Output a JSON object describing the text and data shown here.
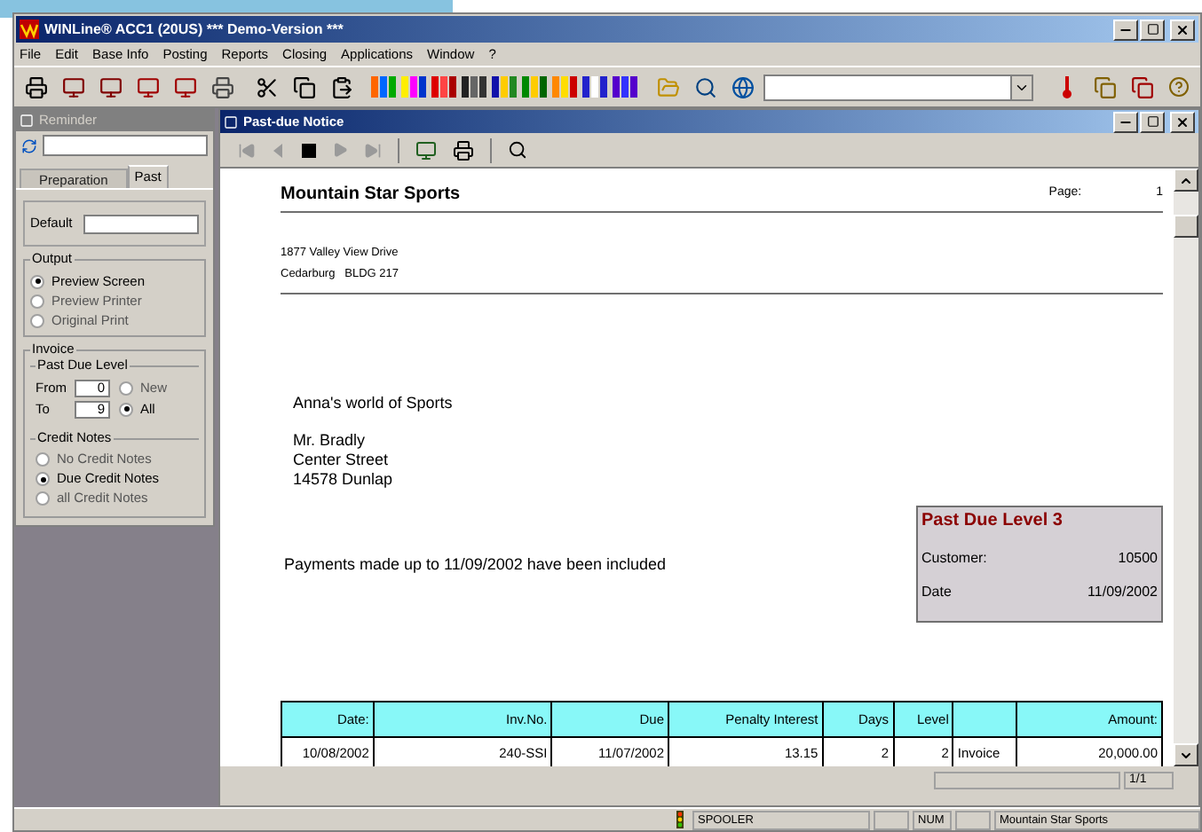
{
  "window": {
    "title": "WINLine® ACC1 (20US) *** Demo-Version ***"
  },
  "menu": [
    "File",
    "Edit",
    "Base Info",
    "Posting",
    "Reports",
    "Closing",
    "Applications",
    "Window",
    "?"
  ],
  "reminder": {
    "title": "Reminder",
    "tabs": [
      {
        "label": "Preparation",
        "selected": false
      },
      {
        "label": "Past",
        "selected": true
      }
    ],
    "default_label": "Default",
    "output": {
      "legend": "Output",
      "options": [
        {
          "label": "Preview Screen",
          "selected": true
        },
        {
          "label": "Preview Printer",
          "selected": false
        },
        {
          "label": "Original Print",
          "selected": false
        }
      ]
    },
    "invoice": {
      "legend": "Invoice",
      "past_due_level": {
        "legend": "Past Due Level",
        "from_label": "From",
        "from_value": "0",
        "to_label": "To",
        "to_value": "9",
        "options": [
          {
            "label": "New",
            "selected": false
          },
          {
            "label": "All",
            "selected": true
          }
        ]
      },
      "credit_notes": {
        "legend": "Credit Notes",
        "options": [
          {
            "label": "No Credit Notes",
            "selected": false
          },
          {
            "label": "Due Credit Notes",
            "selected": true
          },
          {
            "label": "all Credit Notes",
            "selected": false
          }
        ]
      }
    }
  },
  "report": {
    "title": "Past-due Notice",
    "nav": [
      {
        "kind": "first",
        "disabled": true
      },
      {
        "kind": "previous",
        "disabled": true
      },
      {
        "kind": "stop",
        "disabled": false
      },
      {
        "kind": "next",
        "disabled": true
      },
      {
        "kind": "last",
        "disabled": true
      }
    ],
    "company": "Mountain Star Sports",
    "page_label": "Page:",
    "page_number": "1",
    "address": [
      "1877 Valley View Drive",
      "Cedarburg   BLDG 217"
    ],
    "recipient": "Anna's world of Sports",
    "contact": [
      "Mr. Bradly",
      "Center Street",
      "14578 Dunlap"
    ],
    "payments_note": "Payments made up to 11/09/2002 have been included",
    "level_box": {
      "heading": "Past Due Level 3",
      "rows": [
        {
          "label": "Customer:",
          "value": "10500"
        },
        {
          "label": "Date",
          "value": "11/09/2002"
        }
      ]
    },
    "table": {
      "columns": [
        "Date:",
        "Inv.No.",
        "Due",
        "Penalty Interest",
        "Days",
        "Level",
        "",
        "Amount:"
      ],
      "rows": [
        [
          "10/08/2002",
          "240-SSI",
          "11/07/2002",
          "13.15",
          "2",
          "2",
          "Invoice",
          "20,000.00"
        ]
      ]
    },
    "page_indicator": "1/1"
  },
  "status_bar": [
    "SPOOLER",
    "NUM",
    "Mountain Star Sports"
  ]
}
